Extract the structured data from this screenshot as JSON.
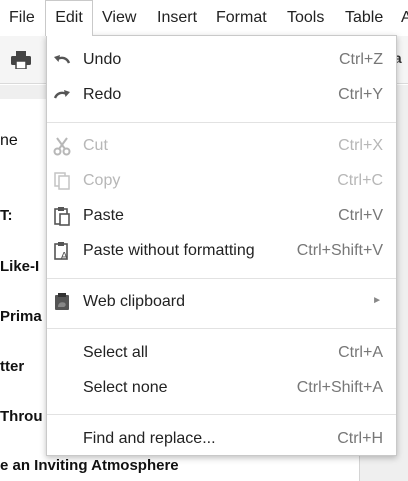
{
  "menubar": {
    "file": "File",
    "edit": "Edit",
    "view": "View",
    "insert": "Insert",
    "format": "Format",
    "tools": "Tools",
    "table": "Table",
    "overflow": "A"
  },
  "toolbar": {
    "print_icon": "printer-icon",
    "partial_text": "ia"
  },
  "document": {
    "lines": [
      "ne",
      "T:",
      "Like-I",
      "Prima",
      "tter",
      " Throu",
      "e an Inviting Atmosphere"
    ]
  },
  "edit_menu": {
    "undo": {
      "label": "Undo",
      "shortcut": "Ctrl+Z",
      "icon": "undo-icon"
    },
    "redo": {
      "label": "Redo",
      "shortcut": "Ctrl+Y",
      "icon": "redo-icon"
    },
    "cut": {
      "label": "Cut",
      "shortcut": "Ctrl+X",
      "icon": "scissors-icon",
      "enabled": false
    },
    "copy": {
      "label": "Copy",
      "shortcut": "Ctrl+C",
      "icon": "copy-icon",
      "enabled": false
    },
    "paste": {
      "label": "Paste",
      "shortcut": "Ctrl+V",
      "icon": "clipboard-icon"
    },
    "paste_plain": {
      "label": "Paste without formatting",
      "shortcut": "Ctrl+Shift+V",
      "icon": "clipboard-text-icon"
    },
    "web_clipboard": {
      "label": "Web clipboard",
      "submenu_arrow": "►",
      "icon": "web-clipboard-icon"
    },
    "select_all": {
      "label": "Select all",
      "shortcut": "Ctrl+A"
    },
    "select_none": {
      "label": "Select none",
      "shortcut": "Ctrl+Shift+A"
    },
    "find_replace": {
      "label": "Find and replace...",
      "shortcut": "Ctrl+H"
    }
  },
  "colors": {
    "menu_text": "#222222",
    "shortcut_text": "#777777",
    "disabled_text": "#b7b7b7",
    "separator": "#e2e2e2",
    "toolbar_bg": "#f5f5f5"
  }
}
